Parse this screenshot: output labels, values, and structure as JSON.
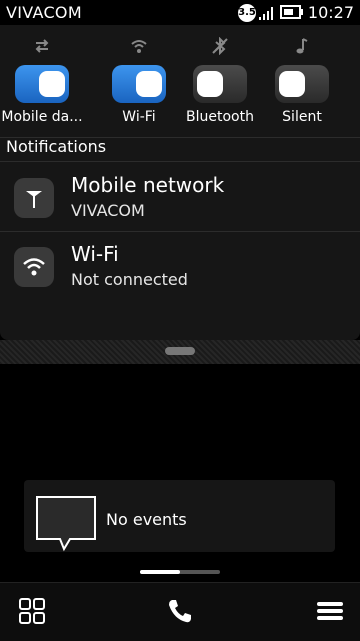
{
  "status": {
    "carrier": "VIVACOM",
    "network_badge": "3.5",
    "time": "10:27"
  },
  "toggles": [
    {
      "label": "Mobile da...",
      "state": "on"
    },
    {
      "label": "Wi-Fi",
      "state": "on"
    },
    {
      "label": "Bluetooth",
      "state": "off"
    },
    {
      "label": "Silent",
      "state": "off"
    }
  ],
  "notifications": {
    "title": "Notifications",
    "items": [
      {
        "title": "Mobile network",
        "subtitle": "VIVACOM"
      },
      {
        "title": "Wi-Fi",
        "subtitle": "Not connected"
      }
    ]
  },
  "events": {
    "text": "No events"
  },
  "colors": {
    "accent": "#2a7fdc",
    "panel": "#161616"
  }
}
